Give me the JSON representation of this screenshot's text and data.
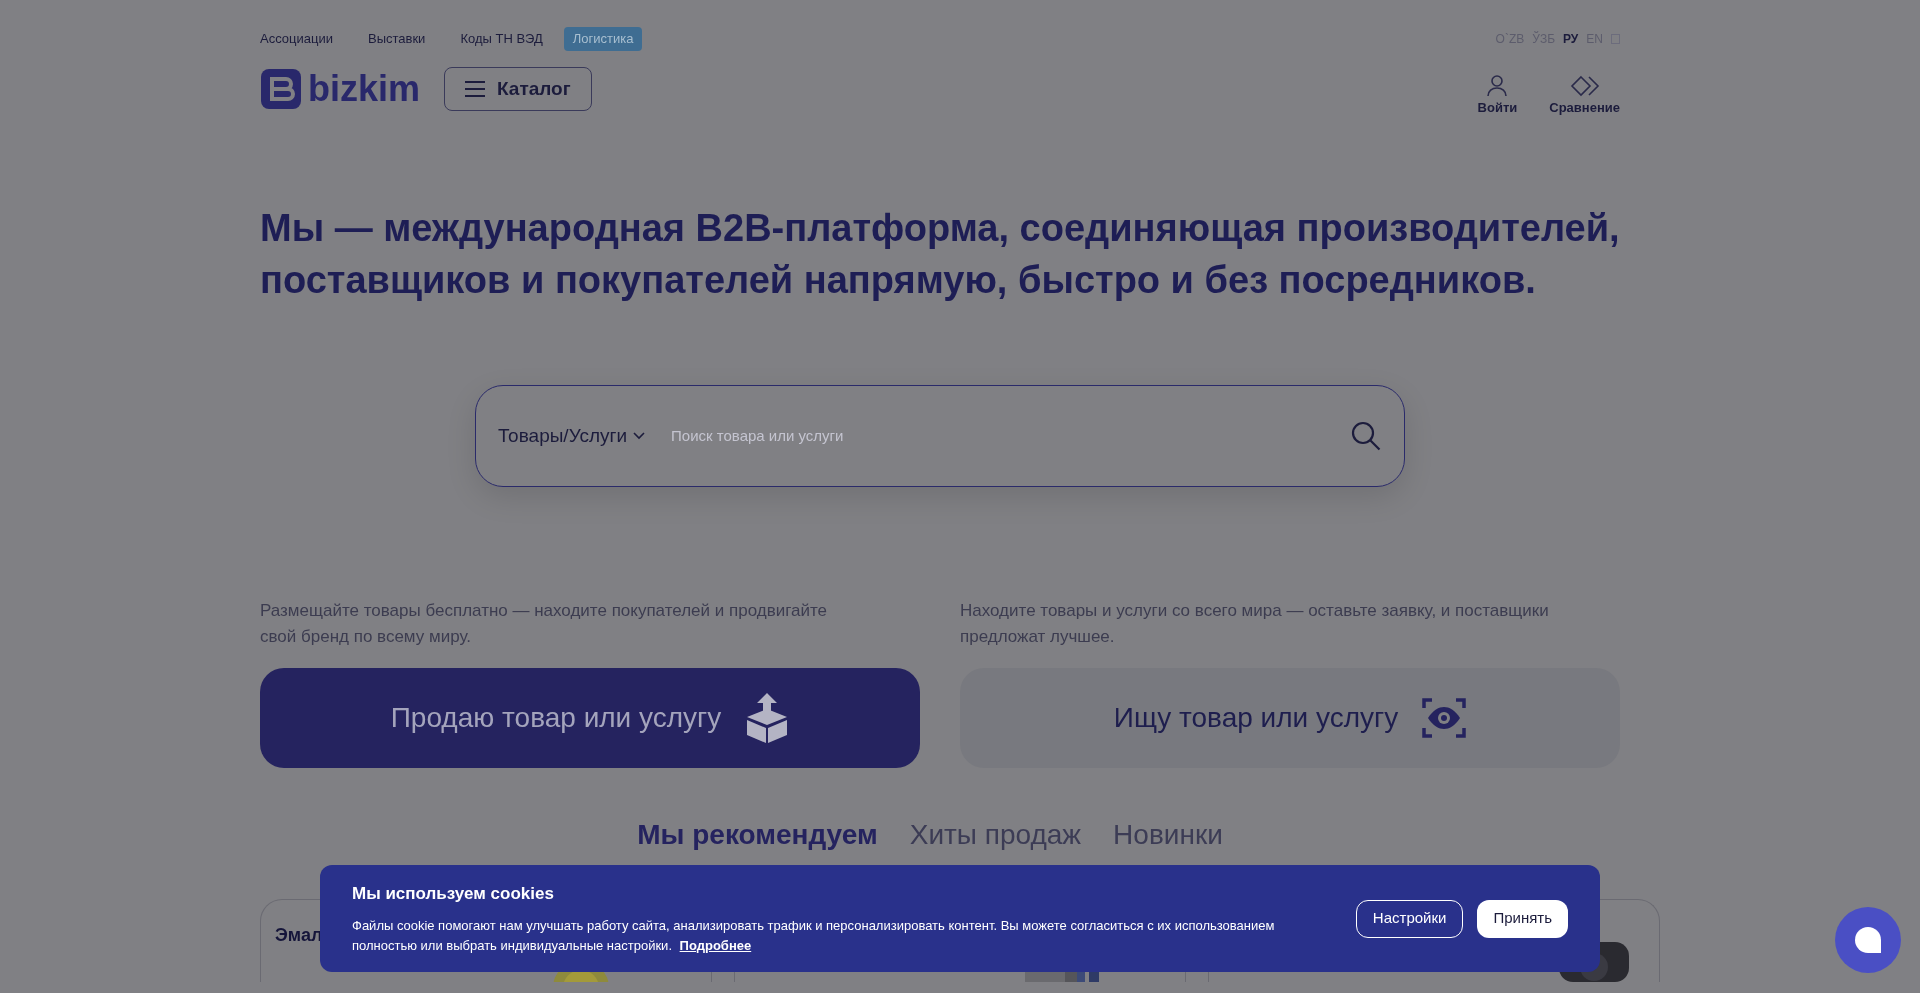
{
  "top_links": [
    {
      "label": "Ассоциации",
      "highlighted": false
    },
    {
      "label": "Выставки",
      "highlighted": false
    },
    {
      "label": "Коды ТН ВЭД",
      "highlighted": false
    },
    {
      "label": "Логистика",
      "highlighted": true
    }
  ],
  "languages": [
    {
      "label": "O`ZB",
      "selected": false
    },
    {
      "label": "ЎЗБ",
      "selected": false
    },
    {
      "label": "РУ",
      "selected": true
    },
    {
      "label": "EN",
      "selected": false
    }
  ],
  "logo": "bizkim",
  "catalog_button": "Каталог",
  "header_actions": [
    {
      "kind": "login",
      "label": "Войти"
    },
    {
      "kind": "compare",
      "label": "Сравнение"
    }
  ],
  "headline": "Мы — международная B2B-платформа, соединяющая производителей, поставщиков и покупателей напрямую, быстро и без посредников.",
  "search": {
    "category": "Товары/Услуги",
    "placeholder": "Поиск товара или услуги"
  },
  "offers": [
    {
      "kind": "sell",
      "text": "Размещайте товары бесплатно — находите покупателей и продвигайте свой бренд по всему миру.",
      "button": "Продаю товар или услугу"
    },
    {
      "kind": "buy",
      "text": "Находите товары и услуги со всего мира — оставьте заявку, и поставщики предложат лучшее.",
      "button": "Ищу товар или услугу"
    }
  ],
  "tabs": [
    {
      "label": "Мы рекомендуем",
      "selected": true
    },
    {
      "label": "Хиты продаж",
      "selected": false
    },
    {
      "label": "Новинки",
      "selected": false
    }
  ],
  "cards": [
    {
      "title": "Эмал",
      "kind": "picture"
    },
    {
      "kind": "picture"
    },
    {
      "kind": "picture"
    }
  ],
  "cookie_banner": {
    "title": "Мы используем cookies",
    "text": "Файлы cookie помогают нам улучшать работу сайта, анализировать трафик и персонализировать контент. Вы можете согласиться с их использованием полностью или выбрать индивидуальные настройки.",
    "link": "Подробнее",
    "buttons": [
      {
        "kind": "settings",
        "label": "Настройки"
      },
      {
        "kind": "accept",
        "label": "Принять"
      }
    ]
  }
}
